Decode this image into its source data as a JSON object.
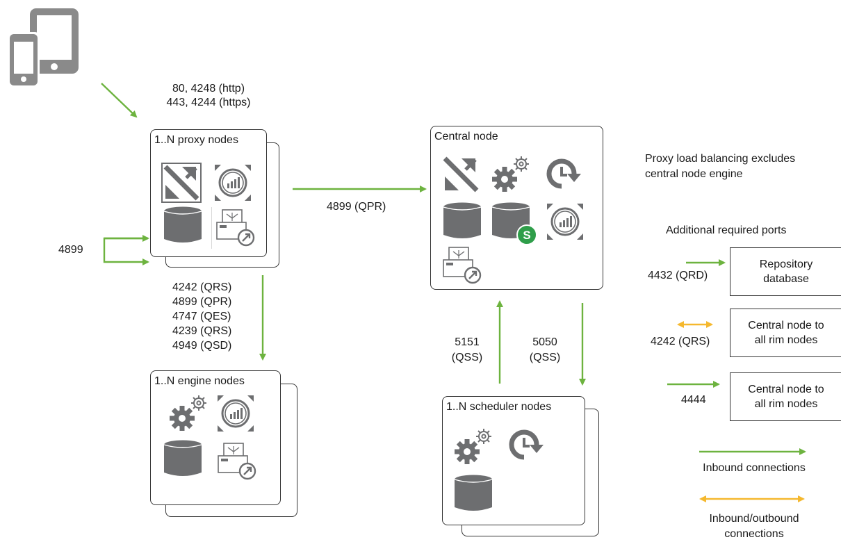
{
  "client_ports": {
    "line1": "80, 4248 (http)",
    "line2": "443, 4244 (https)"
  },
  "proxy": {
    "title": "1..N proxy nodes",
    "self_port": "4899"
  },
  "proxy_to_engine_ports": [
    "4242 (QRS)",
    "4899 (QPR)",
    "4747 (QES)",
    "4239 (QRS)",
    "4949 (QSD)"
  ],
  "proxy_to_central_port": "4899 (QPR)",
  "central": {
    "title": "Central node"
  },
  "engine": {
    "title": "1..N engine nodes"
  },
  "scheduler": {
    "title": "1..N scheduler nodes",
    "up_port": {
      "line1": "5151",
      "line2": "(QSS)"
    },
    "down_port": {
      "line1": "5050",
      "line2": "(QSS)"
    }
  },
  "note": {
    "line1": "Proxy load balancing excludes",
    "line2": "central node engine"
  },
  "additional": {
    "title": "Additional required ports",
    "rows": [
      {
        "port": "4432 (QRD)",
        "box_line1": "Repository",
        "box_line2": "database"
      },
      {
        "port": "4242 (QRS)",
        "box_line1": "Central node to",
        "box_line2": "all rim nodes"
      },
      {
        "port": "4444",
        "box_line1": "Central node to",
        "box_line2": "all rim nodes"
      }
    ]
  },
  "legend": {
    "inbound": "Inbound connections",
    "bidirectional_line1": "Inbound/outbound",
    "bidirectional_line2": "connections"
  },
  "colors": {
    "inbound": "#6db33f",
    "bidirectional": "#f5b82e",
    "icon": "#6d6e70",
    "qlik": "#2f9e4a"
  }
}
